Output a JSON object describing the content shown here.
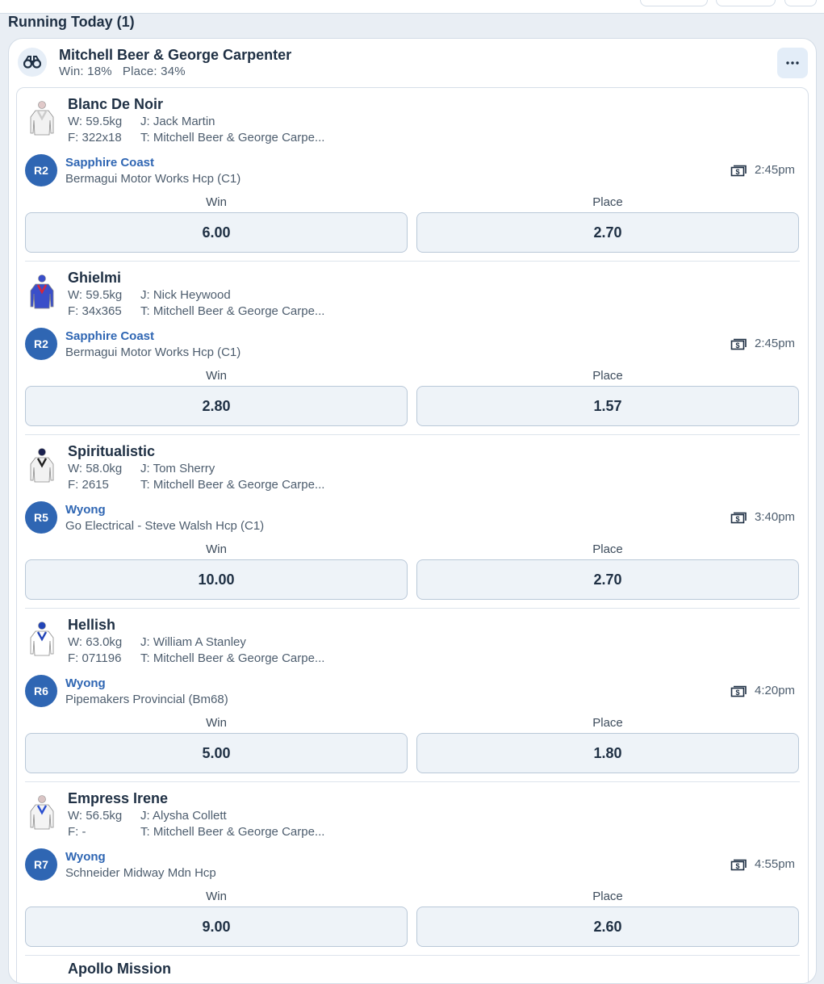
{
  "section": {
    "title": "Running Today (1)"
  },
  "trainer": {
    "name": "Mitchell Beer & George Carpenter",
    "stats": "Win: 18%   Place: 34%"
  },
  "labels": {
    "win": "Win",
    "place": "Place"
  },
  "runners": [
    {
      "name": "Blanc De Noir",
      "weight": "W: 59.5kg",
      "form": "F: 322x18",
      "jockey": "J: Jack Martin",
      "trainer": "T: Mitchell Beer & George Carpe...",
      "race_number": "R2",
      "venue": "Sapphire Coast",
      "race_name": "Bermagui Motor Works Hcp (C1)",
      "time": "2:45pm",
      "win": "6.00",
      "place": "2.70",
      "silk": {
        "body": "#f2f2f2",
        "sleeve": "#e8e8e8",
        "cap": "#e0c9c9",
        "accent": "#cccccc"
      }
    },
    {
      "name": "Ghielmi",
      "weight": "W: 59.5kg",
      "form": "F: 34x365",
      "jockey": "J: Nick Heywood",
      "trainer": "T: Mitchell Beer & George Carpe...",
      "race_number": "R2",
      "venue": "Sapphire Coast",
      "race_name": "Bermagui Motor Works Hcp (C1)",
      "time": "2:45pm",
      "win": "2.80",
      "place": "1.57",
      "silk": {
        "body": "#3a4fc9",
        "sleeve": "#3a4fc9",
        "cap": "#3a4fc9",
        "accent": "#d8263a"
      }
    },
    {
      "name": "Spiritualistic",
      "weight": "W: 58.0kg",
      "form": "F: 2615",
      "jockey": "J: Tom Sherry",
      "trainer": "T: Mitchell Beer & George Carpe...",
      "race_number": "R5",
      "venue": "Wyong",
      "race_name": "Go Electrical - Steve Walsh Hcp (C1)",
      "time": "3:40pm",
      "win": "10.00",
      "place": "2.70",
      "silk": {
        "body": "#f2f2f2",
        "sleeve": "#eeeeee",
        "cap": "#1b2250",
        "accent": "#222222"
      }
    },
    {
      "name": "Hellish",
      "weight": "W: 63.0kg",
      "form": "F: 071196",
      "jockey": "J: William A Stanley",
      "trainer": "T: Mitchell Beer & George Carpe...",
      "race_number": "R6",
      "venue": "Wyong",
      "race_name": "Pipemakers Provincial (Bm68)",
      "time": "4:20pm",
      "win": "5.00",
      "place": "1.80",
      "silk": {
        "body": "#ffffff",
        "sleeve": "#ffffff",
        "cap": "#2345b8",
        "accent": "#2345b8"
      }
    },
    {
      "name": "Empress Irene",
      "weight": "W: 56.5kg",
      "form": "F: -",
      "jockey": "J: Alysha Collett",
      "trainer": "T: Mitchell Beer & George Carpe...",
      "race_number": "R7",
      "venue": "Wyong",
      "race_name": "Schneider Midway Mdn Hcp",
      "time": "4:55pm",
      "win": "9.00",
      "place": "2.60",
      "silk": {
        "body": "#f4f4f4",
        "sleeve": "#f0f0f0",
        "cap": "#d9c4c4",
        "accent": "#2a4fd0"
      }
    }
  ],
  "next_runner_peek": "Apollo Mission",
  "colors": {
    "accent": "#2f66b3",
    "odds_bg": "#eef3f8",
    "odds_border": "#b9c8d8",
    "page_bg": "#e9eef4"
  }
}
